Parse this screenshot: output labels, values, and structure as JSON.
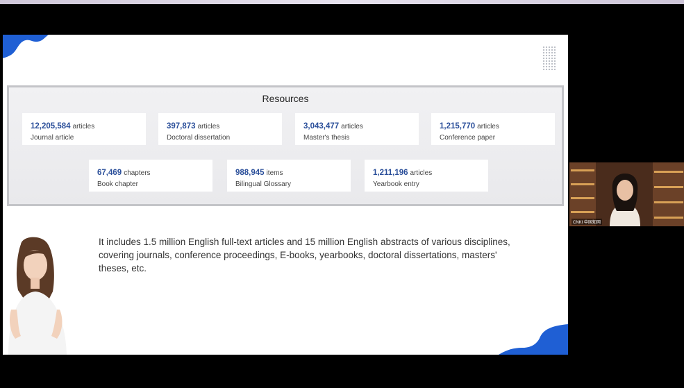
{
  "slide": {
    "resources_title": "Resources",
    "cards": [
      {
        "number": "12,205,584",
        "unit": "articles",
        "label": "Journal article"
      },
      {
        "number": "397,873",
        "unit": "articles",
        "label": "Doctoral dissertation"
      },
      {
        "number": "3,043,477",
        "unit": "articles",
        "label": "Master's thesis"
      },
      {
        "number": "1,215,770",
        "unit": "articles",
        "label": "Conference paper"
      },
      {
        "number": "67,469",
        "unit": "chapters",
        "label": "Book chapter"
      },
      {
        "number": "988,945",
        "unit": "items",
        "label": "Bilingual Glossary"
      },
      {
        "number": "1,211,196",
        "unit": "articles",
        "label": "Yearbook entry"
      }
    ],
    "description": "It includes 1.5 million English full-text articles and 15 million English abstracts of various disciplines, covering journals, conference proceedings, E-books, yearbooks, doctoral dissertations, masters' theses, etc."
  },
  "video": {
    "participant_name": "CNKI 中国知网"
  },
  "colors": {
    "accent_blue": "#1f5fd4",
    "number_blue": "#2b4f9a"
  }
}
